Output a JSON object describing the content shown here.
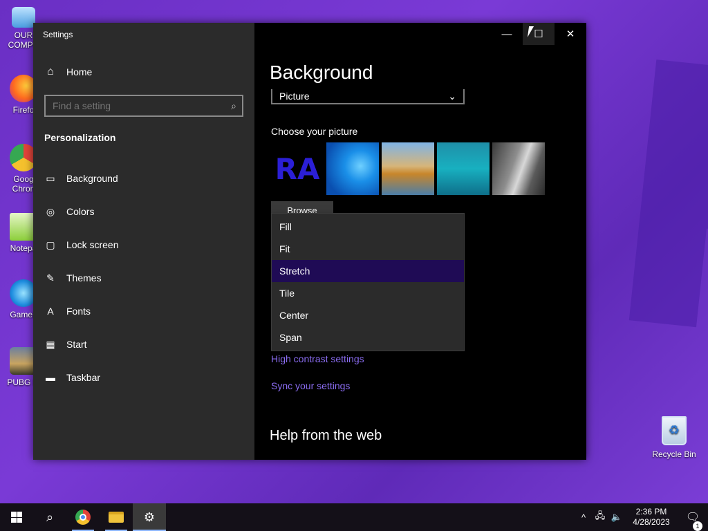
{
  "desktop": {
    "icons": [
      {
        "label": "OUR COMPU",
        "icon": "computer-icon"
      },
      {
        "label": "Firefo",
        "icon": "firefox-icon"
      },
      {
        "label": "Goog Chron",
        "icon": "chrome-icon"
      },
      {
        "label": "Notepa",
        "icon": "notepad-icon"
      },
      {
        "label": "GameL",
        "icon": "gameloop-icon"
      },
      {
        "label": "PUBG M",
        "icon": "pubg-icon"
      }
    ],
    "recycle_bin": {
      "label": "Recycle Bin",
      "icon": "recycle-bin-icon"
    }
  },
  "window": {
    "title": "Settings",
    "controls": {
      "minimize": "—",
      "maximize": "☐",
      "close": "✕"
    }
  },
  "sidebar": {
    "home_label": "Home",
    "search_placeholder": "Find a setting",
    "section_title": "Personalization",
    "items": [
      {
        "label": "Background",
        "icon": "image-icon",
        "glyph": "▭"
      },
      {
        "label": "Colors",
        "icon": "palette-icon",
        "glyph": "◎"
      },
      {
        "label": "Lock screen",
        "icon": "lock-screen-icon",
        "glyph": "▢"
      },
      {
        "label": "Themes",
        "icon": "themes-icon",
        "glyph": "✎"
      },
      {
        "label": "Fonts",
        "icon": "fonts-icon",
        "glyph": "A"
      },
      {
        "label": "Start",
        "icon": "start-icon",
        "glyph": "▦"
      },
      {
        "label": "Taskbar",
        "icon": "taskbar-icon",
        "glyph": "▬"
      }
    ]
  },
  "main": {
    "title": "Background",
    "background_select_value": "Picture",
    "choose_picture_label": "Choose your picture",
    "browse_label": "Browse",
    "fit_options": [
      "Fill",
      "Fit",
      "Stretch",
      "Tile",
      "Center",
      "Span"
    ],
    "fit_selected": "Stretch",
    "links": {
      "high_contrast": "High contrast settings",
      "sync": "Sync your settings"
    },
    "help_title": "Help from the web"
  },
  "taskbar": {
    "clock_time": "2:36 PM",
    "clock_date": "4/28/2023",
    "notification_count": "1"
  },
  "colors": {
    "accent_link": "#8a6cf0",
    "selected_item": "#1f0b55",
    "sidebar_bg": "#2b2b2b",
    "content_bg": "#000000"
  }
}
